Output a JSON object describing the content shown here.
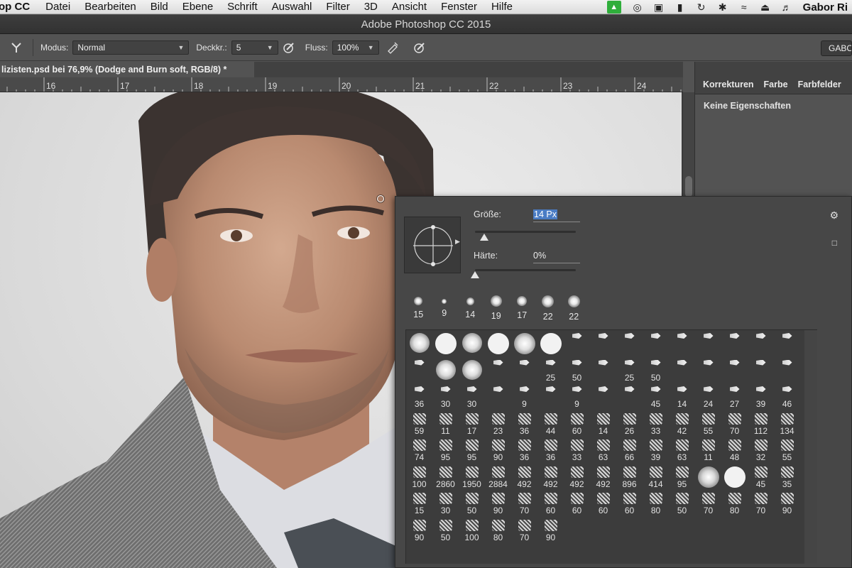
{
  "menubar": {
    "app_name": "op CC",
    "items": [
      "Datei",
      "Bearbeiten",
      "Bild",
      "Ebene",
      "Schrift",
      "Auswahl",
      "Filter",
      "3D",
      "Ansicht",
      "Fenster",
      "Hilfe"
    ],
    "user": "Gabor Ri"
  },
  "window": {
    "title": "Adobe Photoshop CC 2015"
  },
  "options": {
    "modus_label": "Modus:",
    "modus_value": "Normal",
    "deckkr_label": "Deckkr.:",
    "deckkr_value": "5",
    "fluss_label": "Fluss:",
    "fluss_value": "100%",
    "workspace_button": "GABO"
  },
  "document": {
    "tab_title": "lizisten.psd bei 76,9% (Dodge and Burn soft, RGB/8) *",
    "ruler_ticks": [
      "16",
      "17",
      "18",
      "19",
      "20",
      "21",
      "22",
      "23",
      "24"
    ]
  },
  "panel": {
    "tabs": [
      "Korrekturen",
      "Farbe",
      "Farbfelder"
    ],
    "message": "Keine Eigenschaften"
  },
  "brush_picker": {
    "size_label": "Größe:",
    "size_value": "14 Px",
    "size_fraction": 0.09,
    "hardness_label": "Härte:",
    "hardness_value": "0%",
    "hardness_fraction": 0.0,
    "preset_row": [
      {
        "size": "15",
        "d": 12
      },
      {
        "size": "9",
        "d": 7
      },
      {
        "size": "14",
        "d": 11
      },
      {
        "size": "19",
        "d": 16
      },
      {
        "size": "17",
        "d": 14
      },
      {
        "size": "22",
        "d": 17
      },
      {
        "size": "22",
        "d": 17
      }
    ],
    "grid_rows": [
      [
        "",
        "",
        "",
        "",
        "",
        "",
        "",
        "",
        "",
        "",
        "",
        "",
        "",
        "",
        ""
      ],
      [
        "",
        "",
        "",
        "",
        "",
        "25",
        "50",
        "",
        "25",
        "50",
        "",
        "",
        "",
        "",
        ""
      ],
      [
        "36",
        "30",
        "30",
        "",
        "9",
        "",
        "9",
        "",
        "",
        "45",
        "14",
        "24",
        "27",
        "39",
        "46"
      ],
      [
        "59",
        "11",
        "17",
        "23",
        "36",
        "44",
        "60",
        "14",
        "26",
        "33",
        "42",
        "55",
        "70",
        "112",
        "134"
      ],
      [
        "74",
        "95",
        "95",
        "90",
        "36",
        "36",
        "33",
        "63",
        "66",
        "39",
        "63",
        "11",
        "48",
        "32",
        "55"
      ],
      [
        "100",
        "2860",
        "1950",
        "2884",
        "492",
        "492",
        "492",
        "492",
        "896",
        "414",
        "95",
        "",
        "",
        "45",
        "35"
      ],
      [
        "15",
        "30",
        "50",
        "90",
        "70",
        "60",
        "60",
        "60",
        "60",
        "80",
        "50",
        "70",
        "80",
        "70",
        "90"
      ],
      [
        "90",
        "50",
        "100",
        "80",
        "70",
        "90",
        "",
        "",
        "",
        "",
        "",
        "",
        "",
        "",
        ""
      ]
    ]
  }
}
